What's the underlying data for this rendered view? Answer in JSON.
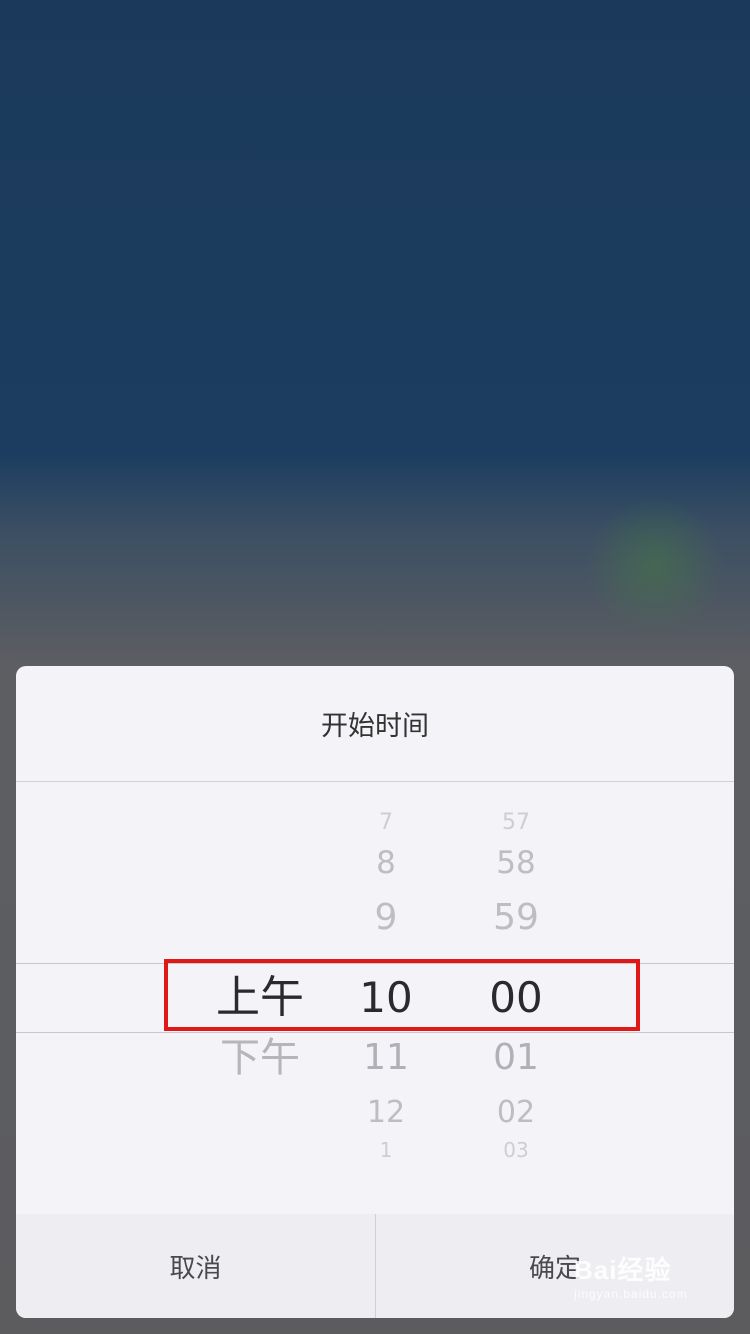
{
  "dialog": {
    "title": "开始时间",
    "cancel_label": "取消",
    "confirm_label": "确定"
  },
  "picker": {
    "period": {
      "selected": "上午",
      "options": [
        "上午",
        "下午"
      ]
    },
    "hour": {
      "selected": "10",
      "above": [
        "7",
        "8",
        "9"
      ],
      "below": [
        "11",
        "12",
        "1"
      ]
    },
    "minute": {
      "selected": "00",
      "above": [
        "57",
        "58",
        "59"
      ],
      "below": [
        "01",
        "02",
        "03"
      ]
    }
  },
  "watermark": {
    "logo": "Bai经验",
    "url": "jingyan.baidu.com"
  },
  "colors": {
    "highlight_border": "#e11818",
    "sheet_background": "#f4f4f8"
  }
}
